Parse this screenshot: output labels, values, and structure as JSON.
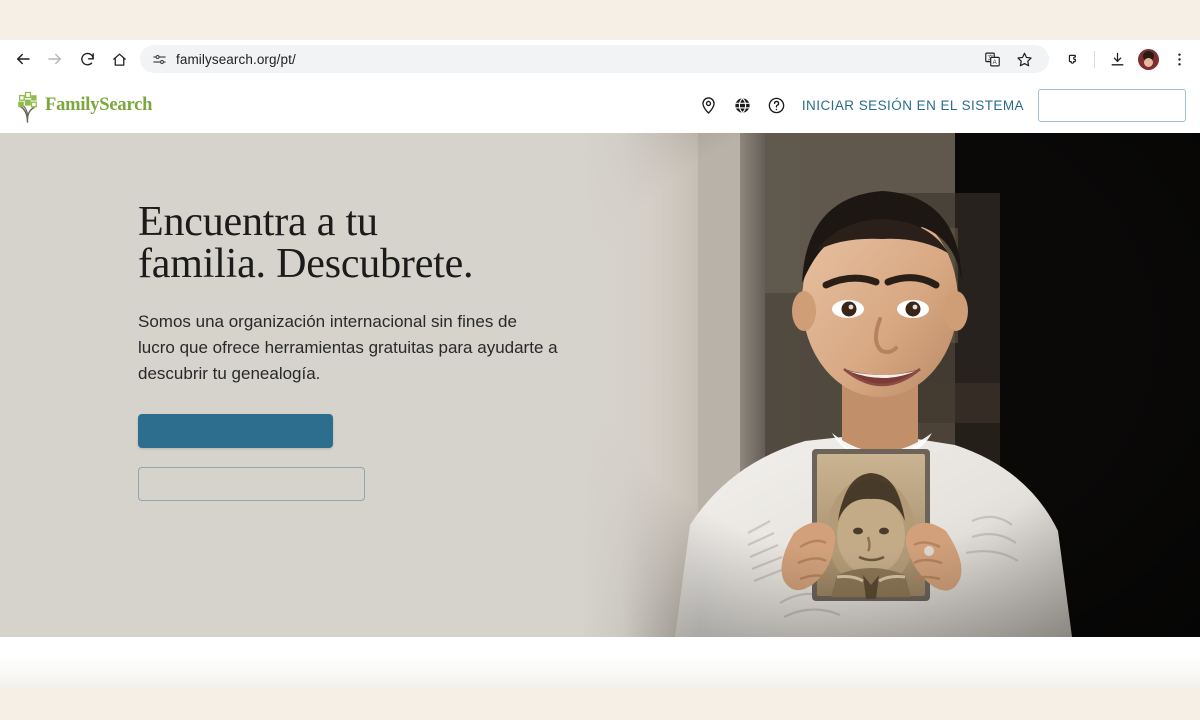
{
  "browser": {
    "back_icon": "arrow-left-icon",
    "forward_icon": "arrow-right-icon",
    "reload_icon": "reload-icon",
    "home_icon": "home-icon",
    "site_settings_icon": "tune-sliders-icon",
    "url": "familysearch.org/pt/",
    "translate_icon": "translate-icon",
    "bookmark_icon": "star-icon",
    "extensions_icon": "puzzle-piece-icon",
    "downloads_icon": "download-icon",
    "profile_icon": "profile-avatar-icon",
    "menu_icon": "three-dots-vertical-icon"
  },
  "site_header": {
    "logo_text": "FamilySearch",
    "logo_color": "#7aa83c",
    "location_icon": "map-pin-icon",
    "globe_icon": "globe-icon",
    "help_icon": "question-circle-icon",
    "signin_label": "INICIAR SESIÓN EN EL SISTEMA",
    "signin_color": "#2b6c8c",
    "cta_label": ""
  },
  "hero": {
    "title_line1": "Encuentra a tu",
    "title_line2": "familia. Descubrete.",
    "subtitle": "Somos una organización internacional sin fines de lucro que ofrece herramientas gratuitas para ayudarte a descubrir tu genealogía.",
    "primary_button_label": "",
    "primary_button_color": "#2d6e8e",
    "secondary_button_label": "",
    "background_color": "#d6d2cc",
    "photo_alt": "Smiling boy in white t-shirt holding an old sepia portrait photograph"
  },
  "page_colors": {
    "browser_chrome": "#f6efe6",
    "toolbar": "#ffffff",
    "below_hero": "#ffffff",
    "footer_band": "#f6efe6"
  }
}
